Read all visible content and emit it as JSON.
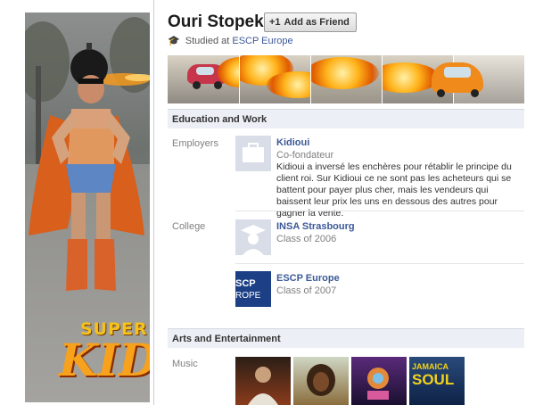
{
  "profile": {
    "name": "Ouri Stopek",
    "add_friend_label": "Add as Friend",
    "studied_prefix": "Studied at",
    "studied_school": "ESCP Europe",
    "logo_text_top": "SUPER",
    "logo_text_bottom": "KIDI"
  },
  "sections": {
    "education_work": "Education and Work",
    "arts": "Arts and Entertainment"
  },
  "employers": {
    "label": "Employers",
    "items": [
      {
        "name": "Kidioui",
        "role": "Co-fondateur",
        "description": "Kidioui a inversé les enchères pour rétablir le principe du client roi. Sur Kidioui ce ne sont pas les acheteurs qui se battent pour payer plus cher, mais les vendeurs qui baissent leur prix les uns en dessous des autres pour gagner la vente."
      }
    ]
  },
  "college": {
    "label": "College",
    "items": [
      {
        "name": "INSA Strasbourg",
        "detail": "Class of 2006"
      },
      {
        "name": "ESCP Europe",
        "detail": "Class of 2007",
        "logo_text_1": "SCP",
        "logo_text_2": "ROPE"
      }
    ]
  },
  "music": {
    "label": "Music",
    "albums": [
      {
        "icon": "album-michael-jackson"
      },
      {
        "icon": "album-bob-marley"
      },
      {
        "icon": "album-kanye-graduation"
      },
      {
        "icon": "album-jamaica-soul",
        "text_1": "JAMAICA",
        "text_2": "SOUL"
      }
    ]
  }
}
